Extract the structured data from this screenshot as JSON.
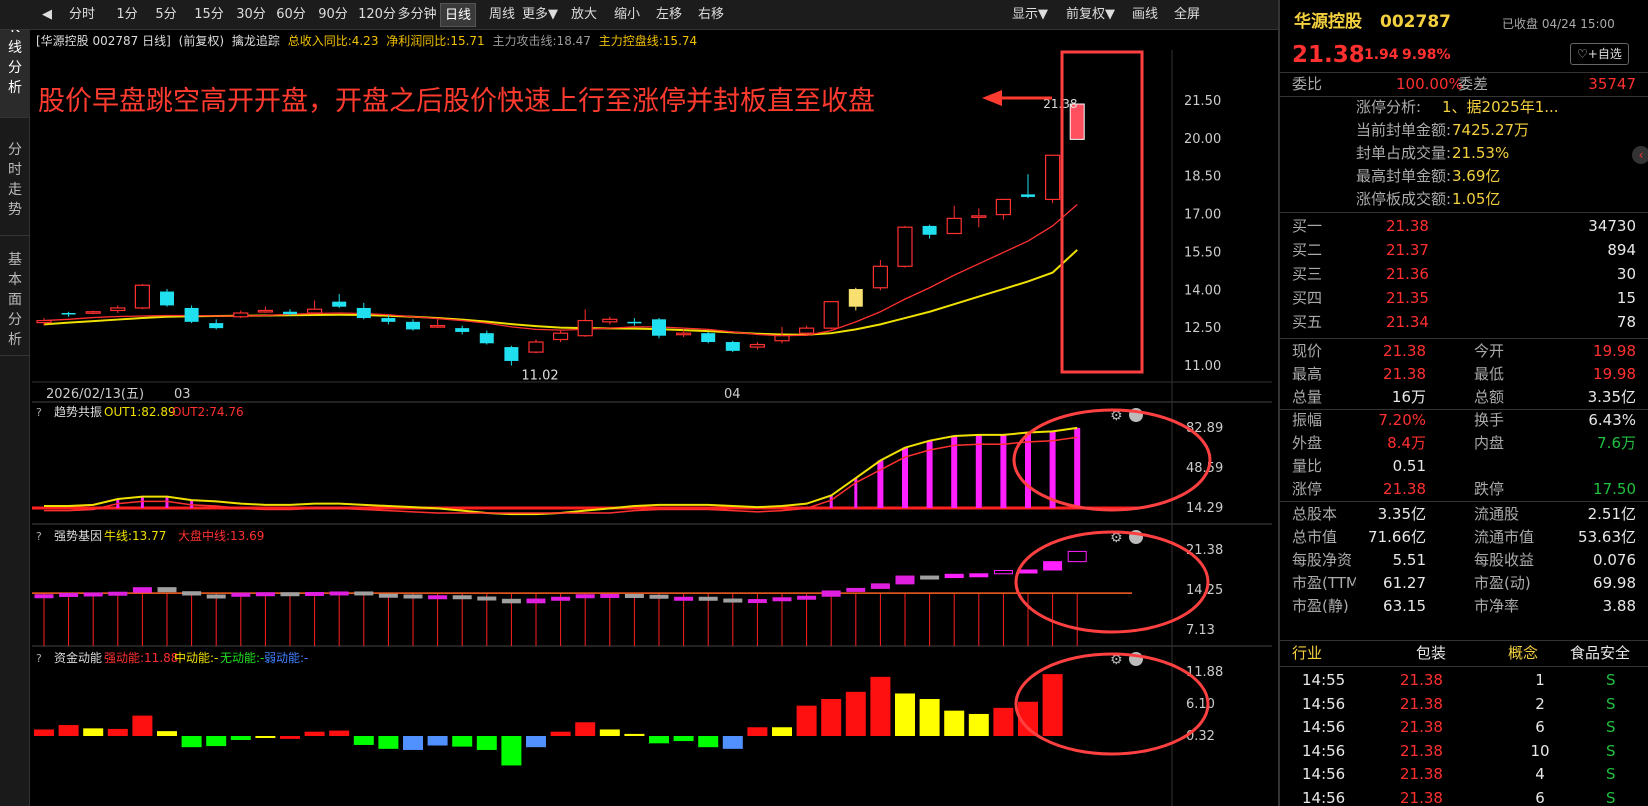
{
  "toolbar": {
    "back": "◀",
    "items": [
      "分时",
      "1分",
      "5分",
      "15分",
      "30分",
      "60分",
      "90分",
      "120分",
      "多分钟",
      "日线",
      "周线",
      "更多▼",
      "放大",
      "缩小",
      "左移",
      "右移"
    ],
    "active": "日线",
    "right_items": [
      "显示▼",
      "前复权▼",
      "画线",
      "全屏"
    ]
  },
  "left_tabs": [
    "K线分析",
    "分时走势",
    "基本面分析"
  ],
  "chart_header": {
    "stock": "[华源控股 002787 日线]",
    "adjust": "(前复权)",
    "indicator": "擒龙追踪",
    "rev": "总收入同比:4.23",
    "profit": "净利润同比:15.71",
    "attack": "主力攻击线:18.47",
    "control": "主力控盘线:15.74"
  },
  "annotation": "股价早盘跳空高开开盘，开盘之后股价快速上行至涨停并封板直至收盘",
  "price_axis": [
    "21.50",
    "20.00",
    "18.50",
    "17.00",
    "15.50",
    "14.00",
    "12.50",
    "11.00"
  ],
  "date_labels": {
    "start": "2026/02/13(五)",
    "m1": "03",
    "m2": "04"
  },
  "low_label": "11.02",
  "high_label": "21.38",
  "candles": [
    [
      12.72,
      12.8,
      12.6,
      12.9
    ],
    [
      13.1,
      13.05,
      12.95,
      13.15
    ],
    [
      13.1,
      13.15,
      13.05,
      13.2
    ],
    [
      13.2,
      13.3,
      13.1,
      13.4
    ],
    [
      13.3,
      14.2,
      13.25,
      14.25
    ],
    [
      13.95,
      13.4,
      13.35,
      14.05
    ],
    [
      13.3,
      12.75,
      12.7,
      13.4
    ],
    [
      12.7,
      12.5,
      12.45,
      12.85
    ],
    [
      12.95,
      13.1,
      12.9,
      13.2
    ],
    [
      13.15,
      13.2,
      13.1,
      13.35
    ],
    [
      13.15,
      13.05,
      13,
      13.25
    ],
    [
      13.1,
      13.25,
      13.05,
      13.6
    ],
    [
      13.55,
      13.35,
      13.3,
      13.85
    ],
    [
      13.3,
      12.9,
      12.85,
      13.5
    ],
    [
      12.9,
      12.75,
      12.65,
      13.0
    ],
    [
      12.75,
      12.45,
      12.4,
      12.85
    ],
    [
      12.55,
      12.6,
      12.5,
      12.85
    ],
    [
      12.5,
      12.35,
      12.25,
      12.6
    ],
    [
      12.3,
      11.9,
      11.85,
      12.4
    ],
    [
      11.75,
      11.2,
      11.02,
      11.8
    ],
    [
      11.55,
      11.95,
      11.5,
      12.05
    ],
    [
      12.05,
      12.3,
      11.95,
      12.4
    ],
    [
      12.2,
      12.8,
      12.15,
      13.25
    ],
    [
      12.75,
      12.85,
      12.65,
      12.95
    ],
    [
      12.75,
      12.7,
      12.6,
      12.9
    ],
    [
      12.85,
      12.2,
      12.1,
      12.9
    ],
    [
      12.25,
      12.3,
      12.15,
      12.45
    ],
    [
      12.3,
      11.95,
      11.9,
      12.35
    ],
    [
      11.95,
      11.6,
      11.55,
      12.0
    ],
    [
      11.75,
      11.85,
      11.65,
      11.95
    ],
    [
      12.0,
      12.2,
      11.9,
      12.55
    ],
    [
      12.3,
      12.5,
      12.2,
      12.6
    ],
    [
      12.5,
      13.55,
      12.45,
      13.55
    ],
    [
      13.35,
      14.05,
      13.2,
      14.1
    ],
    [
      14.1,
      14.95,
      14.0,
      15.2
    ],
    [
      14.95,
      16.5,
      14.9,
      16.55
    ],
    [
      16.55,
      16.2,
      16.05,
      16.6
    ],
    [
      16.25,
      16.85,
      16.3,
      17.35
    ],
    [
      16.95,
      16.95,
      16.5,
      17.25
    ],
    [
      17.0,
      17.6,
      16.8,
      17.6
    ],
    [
      17.8,
      17.7,
      17.65,
      18.6
    ],
    [
      17.6,
      19.35,
      17.45,
      19.35
    ],
    [
      19.98,
      21.38,
      19.98,
      21.38
    ]
  ],
  "ma_red": [
    12.8,
    12.85,
    12.92,
    12.96,
    12.98,
    13.0,
    13.0,
    12.98,
    12.98,
    13.0,
    13.05,
    13.08,
    13.1,
    13.08,
    13.03,
    12.95,
    12.88,
    12.8,
    12.7,
    12.55,
    12.45,
    12.42,
    12.45,
    12.5,
    12.55,
    12.55,
    12.5,
    12.45,
    12.35,
    12.25,
    12.2,
    12.22,
    12.4,
    12.75,
    13.15,
    13.65,
    14.1,
    14.6,
    15.05,
    15.5,
    15.95,
    16.55,
    17.4
  ],
  "ma_yellow": [
    12.65,
    12.72,
    12.78,
    12.84,
    12.9,
    12.95,
    12.97,
    12.98,
    12.99,
    13.0,
    13.01,
    13.02,
    13.03,
    13.02,
    12.99,
    12.95,
    12.9,
    12.84,
    12.76,
    12.66,
    12.58,
    12.52,
    12.5,
    12.49,
    12.48,
    12.46,
    12.42,
    12.38,
    12.33,
    12.28,
    12.25,
    12.24,
    12.3,
    12.45,
    12.65,
    12.9,
    13.15,
    13.45,
    13.75,
    14.05,
    14.35,
    14.7,
    15.6
  ],
  "panel1": {
    "title": "趋势共振",
    "out1": "OUT1:82.89",
    "out2": "OUT2:74.76",
    "axis": [
      "82.89",
      "48.59",
      "14.29"
    ],
    "bars": [
      16,
      16,
      17,
      22,
      24,
      24,
      21,
      20,
      18,
      17,
      17,
      18,
      18,
      17,
      16,
      15,
      14,
      12,
      10,
      9,
      9,
      10,
      12,
      14,
      16,
      17,
      17,
      17,
      16,
      15,
      16,
      18,
      25,
      40,
      55,
      66,
      72,
      76,
      77,
      77,
      79,
      80,
      83
    ]
  },
  "panel2": {
    "title": "强势基因",
    "bull": "牛线:13.77",
    "big": "大盘中线:13.69",
    "axis": [
      "21.38",
      "14.25",
      "7.13"
    ]
  },
  "panel3": {
    "title": "资金动能",
    "strong": "强动能:11.88",
    "mid": "中动能:-",
    "none": "无动能:-",
    "weak": "弱动能:-",
    "axis": [
      "11.88",
      "6.10",
      "0.32"
    ],
    "bars": [
      1.5,
      2.3,
      1.7,
      1.6,
      4.0,
      1.2,
      -1.7,
      -1.5,
      -0.4,
      0.3,
      -0.2,
      1.1,
      1.3,
      -1.3,
      -2.0,
      -2.2,
      -1.4,
      -1.6,
      -2.2,
      -5.0,
      -1.7,
      1.1,
      2.8,
      1.5,
      0.7,
      -1.0,
      -0.6,
      -1.7,
      -2.0,
      1.9,
      1.9,
      5.8,
      7.0,
      8.3,
      11.0,
      8.0,
      7.0,
      4.9,
      4.3,
      5.4,
      6.5,
      11.5
    ],
    "colors": [
      "r",
      "r",
      "y",
      "r",
      "r",
      "y",
      "g",
      "g",
      "g",
      "y",
      "r",
      "r",
      "r",
      "g",
      "g",
      "b",
      "b",
      "g",
      "g",
      "g",
      "b",
      "r",
      "r",
      "y",
      "y",
      "g",
      "g",
      "g",
      "b",
      "r",
      "y",
      "r",
      "r",
      "r",
      "r",
      "y",
      "y",
      "y",
      "y",
      "r",
      "r",
      "r"
    ]
  },
  "right": {
    "name": "华源控股",
    "code": "002787",
    "status": "已收盘 04/24 15:00",
    "price": "21.38",
    "change": "1.94",
    "pct": "9.98%",
    "fav": "+自选",
    "weibi_label": "委比",
    "weibi": "100.00%",
    "weicha_label": "委差",
    "weicha": "35747",
    "zt": [
      [
        "涨停分析:",
        "1、据2025年1..."
      ],
      [
        "当前封单金额:",
        "7425.27万"
      ],
      [
        "封单占成交量:",
        "21.53%"
      ],
      [
        "最高封单金额:",
        "3.69亿"
      ],
      [
        "涨停板成交额:",
        "1.05亿"
      ]
    ],
    "bids": [
      [
        "买一",
        "21.38",
        "34730"
      ],
      [
        "买二",
        "21.37",
        "894"
      ],
      [
        "买三",
        "21.36",
        "30"
      ],
      [
        "买四",
        "21.35",
        "15"
      ],
      [
        "买五",
        "21.34",
        "78"
      ]
    ],
    "stats": [
      [
        "现价",
        "21.38",
        "今开",
        "19.98"
      ],
      [
        "最高",
        "21.38",
        "最低",
        "19.98"
      ],
      [
        "总量",
        "16万",
        "总额",
        "3.35亿"
      ],
      [
        "振幅",
        "7.20%",
        "换手",
        "6.43%"
      ],
      [
        "外盘",
        "8.4万",
        "内盘",
        "7.6万"
      ],
      [
        "量比",
        "0.51",
        "",
        ""
      ],
      [
        "涨停",
        "21.38",
        "跌停",
        "17.50"
      ],
      [
        "总股本",
        "3.35亿",
        "流通股",
        "2.51亿"
      ],
      [
        "总市值",
        "71.66亿",
        "流通市值",
        "53.63亿"
      ],
      [
        "每股净资",
        "5.51",
        "每股收益",
        "0.076"
      ],
      [
        "市盈(TTM",
        "61.27",
        "市盈(动)",
        "69.98"
      ],
      [
        "市盈(静)",
        "63.15",
        "市净率",
        "3.88"
      ]
    ],
    "industry": [
      "行业",
      "包装",
      "概念",
      "食品安全"
    ],
    "ticks": [
      [
        "14:55",
        "21.38",
        "1",
        "S"
      ],
      [
        "14:56",
        "21.38",
        "2",
        "S"
      ],
      [
        "14:56",
        "21.38",
        "6",
        "S"
      ],
      [
        "14:56",
        "21.38",
        "10",
        "S"
      ],
      [
        "14:56",
        "21.38",
        "4",
        "S"
      ],
      [
        "14:56",
        "21.38",
        "6",
        "S"
      ]
    ]
  },
  "colors": {
    "up": "#ff3030",
    "down": "#20e0f0",
    "ma_yellow": "#f0e000",
    "ma_red": "#ff3030",
    "magenta": "#ff20ff",
    "annotation": "#ff3b30"
  }
}
